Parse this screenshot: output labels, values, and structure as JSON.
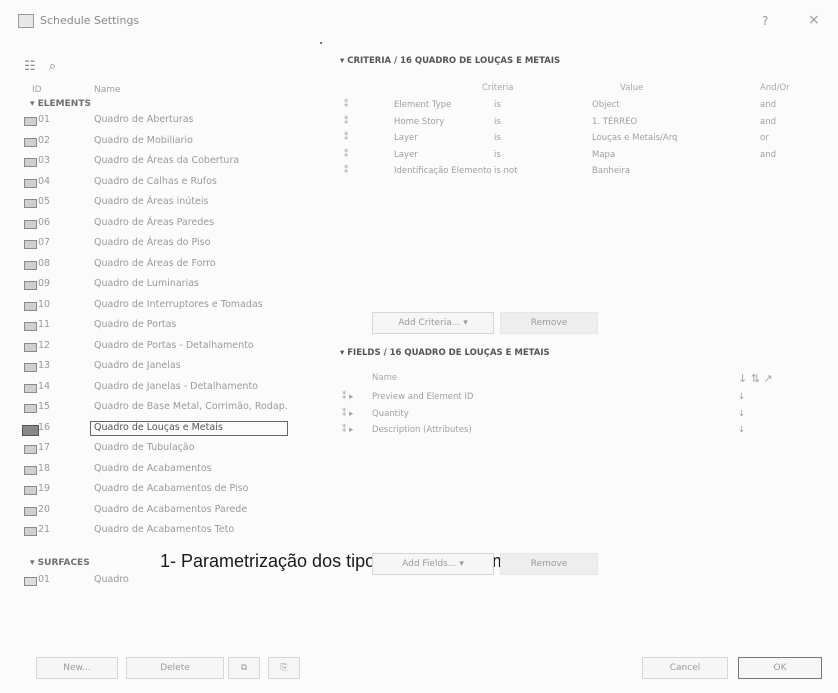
{
  "window": {
    "title": "Schedule Settings",
    "help": "?",
    "close": "×"
  },
  "left": {
    "col_id": "ID",
    "col_name": "Name",
    "elements_label": "ELEMENTS",
    "surfaces_label": "SURFACES",
    "items": [
      {
        "id": "01",
        "name": "Quadro de Aberturas"
      },
      {
        "id": "02",
        "name": "Quadro de Mobiliario"
      },
      {
        "id": "03",
        "name": "Quadro de Áreas da Cobertura"
      },
      {
        "id": "04",
        "name": "Quadro de Calhas e Rufos"
      },
      {
        "id": "05",
        "name": "Quadro de Áreas inúteis"
      },
      {
        "id": "06",
        "name": "Quadro de Áreas Paredes"
      },
      {
        "id": "07",
        "name": "Quadro de Áreas do Piso"
      },
      {
        "id": "08",
        "name": "Quadro de Áreas de Forro"
      },
      {
        "id": "09",
        "name": "Quadro de Luminarias"
      },
      {
        "id": "10",
        "name": "Quadro de Interruptores e Tomadas"
      },
      {
        "id": "11",
        "name": "Quadro de Portas"
      },
      {
        "id": "12",
        "name": "Quadro de Portas - Detalhamento"
      },
      {
        "id": "13",
        "name": "Quadro de Janelas"
      },
      {
        "id": "14",
        "name": "Quadro de Janelas - Detalhamento"
      },
      {
        "id": "15",
        "name": "Quadro de Base Metal, Corrimão, Rodap."
      },
      {
        "id": "16",
        "name": "Quadro de Louças e Metais",
        "selected": true
      },
      {
        "id": "17",
        "name": "Quadro de Tubulação"
      },
      {
        "id": "18",
        "name": "Quadro de Acabamentos"
      },
      {
        "id": "19",
        "name": "Quadro de Acabamentos de Piso"
      },
      {
        "id": "20",
        "name": "Quadro de Acabamentos Parede"
      },
      {
        "id": "21",
        "name": "Quadro de Acabamentos Teto"
      }
    ],
    "surface_items": [
      {
        "id": "01",
        "name": "Quadro"
      }
    ]
  },
  "caption": "1- Parametrização dos tipos de Louças e metais",
  "criteria": {
    "title": "CRITERIA / 16 QUADRO DE LOUÇAS E METAIS",
    "col_criteria": "Criteria",
    "col_value": "Value",
    "col_andor": "And/Or",
    "rows": [
      {
        "field": "Element Type",
        "op": "is",
        "value": "Object",
        "andor": "and"
      },
      {
        "field": "Home Story",
        "op": "is",
        "value": "1. TÉRREO",
        "andor": "and"
      },
      {
        "field": "Layer",
        "op": "is",
        "value": "Louças e Metais/Arq",
        "andor": "or"
      },
      {
        "field": "Layer",
        "op": "is",
        "value": "Mapa",
        "andor": "and"
      },
      {
        "field": "Identificação Elemento",
        "op": "is not",
        "value": "Banheira",
        "andor": ""
      }
    ],
    "add_button": "Add Criteria...",
    "remove_button": "Remove"
  },
  "fields": {
    "title": "FIELDS / 16 QUADRO DE LOUÇAS E METAIS",
    "col_name": "Name",
    "rows": [
      {
        "name": "Preview and Element ID"
      },
      {
        "name": "Quantity"
      },
      {
        "name": "Description (Attributes)"
      }
    ],
    "add_button": "Add Fields...",
    "remove_button": "Remove"
  },
  "bottom": {
    "new": "New...",
    "delete": "Delete",
    "cancel": "Cancel",
    "ok": "OK"
  }
}
